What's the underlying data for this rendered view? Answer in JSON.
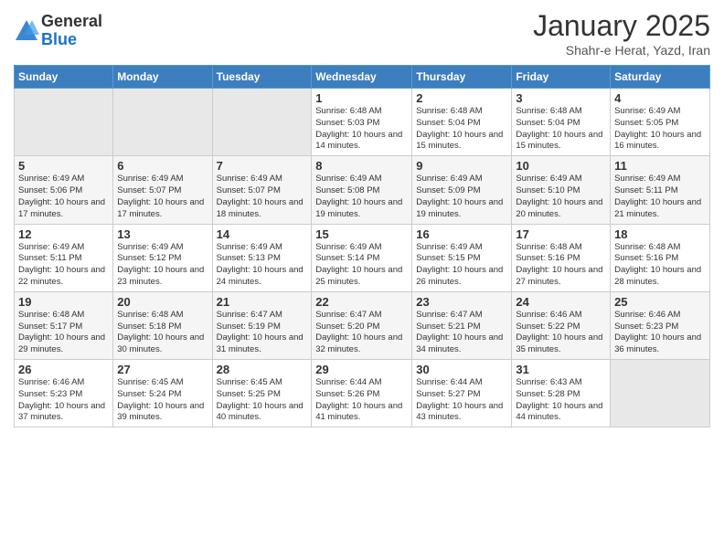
{
  "logo": {
    "general": "General",
    "blue": "Blue"
  },
  "title": "January 2025",
  "subtitle": "Shahr-e Herat, Yazd, Iran",
  "days_of_week": [
    "Sunday",
    "Monday",
    "Tuesday",
    "Wednesday",
    "Thursday",
    "Friday",
    "Saturday"
  ],
  "weeks": [
    [
      {
        "day": "",
        "info": ""
      },
      {
        "day": "",
        "info": ""
      },
      {
        "day": "",
        "info": ""
      },
      {
        "day": "1",
        "info": "Sunrise: 6:48 AM\nSunset: 5:03 PM\nDaylight: 10 hours and 14 minutes."
      },
      {
        "day": "2",
        "info": "Sunrise: 6:48 AM\nSunset: 5:04 PM\nDaylight: 10 hours and 15 minutes."
      },
      {
        "day": "3",
        "info": "Sunrise: 6:48 AM\nSunset: 5:04 PM\nDaylight: 10 hours and 15 minutes."
      },
      {
        "day": "4",
        "info": "Sunrise: 6:49 AM\nSunset: 5:05 PM\nDaylight: 10 hours and 16 minutes."
      }
    ],
    [
      {
        "day": "5",
        "info": "Sunrise: 6:49 AM\nSunset: 5:06 PM\nDaylight: 10 hours and 17 minutes."
      },
      {
        "day": "6",
        "info": "Sunrise: 6:49 AM\nSunset: 5:07 PM\nDaylight: 10 hours and 17 minutes."
      },
      {
        "day": "7",
        "info": "Sunrise: 6:49 AM\nSunset: 5:07 PM\nDaylight: 10 hours and 18 minutes."
      },
      {
        "day": "8",
        "info": "Sunrise: 6:49 AM\nSunset: 5:08 PM\nDaylight: 10 hours and 19 minutes."
      },
      {
        "day": "9",
        "info": "Sunrise: 6:49 AM\nSunset: 5:09 PM\nDaylight: 10 hours and 19 minutes."
      },
      {
        "day": "10",
        "info": "Sunrise: 6:49 AM\nSunset: 5:10 PM\nDaylight: 10 hours and 20 minutes."
      },
      {
        "day": "11",
        "info": "Sunrise: 6:49 AM\nSunset: 5:11 PM\nDaylight: 10 hours and 21 minutes."
      }
    ],
    [
      {
        "day": "12",
        "info": "Sunrise: 6:49 AM\nSunset: 5:11 PM\nDaylight: 10 hours and 22 minutes."
      },
      {
        "day": "13",
        "info": "Sunrise: 6:49 AM\nSunset: 5:12 PM\nDaylight: 10 hours and 23 minutes."
      },
      {
        "day": "14",
        "info": "Sunrise: 6:49 AM\nSunset: 5:13 PM\nDaylight: 10 hours and 24 minutes."
      },
      {
        "day": "15",
        "info": "Sunrise: 6:49 AM\nSunset: 5:14 PM\nDaylight: 10 hours and 25 minutes."
      },
      {
        "day": "16",
        "info": "Sunrise: 6:49 AM\nSunset: 5:15 PM\nDaylight: 10 hours and 26 minutes."
      },
      {
        "day": "17",
        "info": "Sunrise: 6:48 AM\nSunset: 5:16 PM\nDaylight: 10 hours and 27 minutes."
      },
      {
        "day": "18",
        "info": "Sunrise: 6:48 AM\nSunset: 5:16 PM\nDaylight: 10 hours and 28 minutes."
      }
    ],
    [
      {
        "day": "19",
        "info": "Sunrise: 6:48 AM\nSunset: 5:17 PM\nDaylight: 10 hours and 29 minutes."
      },
      {
        "day": "20",
        "info": "Sunrise: 6:48 AM\nSunset: 5:18 PM\nDaylight: 10 hours and 30 minutes."
      },
      {
        "day": "21",
        "info": "Sunrise: 6:47 AM\nSunset: 5:19 PM\nDaylight: 10 hours and 31 minutes."
      },
      {
        "day": "22",
        "info": "Sunrise: 6:47 AM\nSunset: 5:20 PM\nDaylight: 10 hours and 32 minutes."
      },
      {
        "day": "23",
        "info": "Sunrise: 6:47 AM\nSunset: 5:21 PM\nDaylight: 10 hours and 34 minutes."
      },
      {
        "day": "24",
        "info": "Sunrise: 6:46 AM\nSunset: 5:22 PM\nDaylight: 10 hours and 35 minutes."
      },
      {
        "day": "25",
        "info": "Sunrise: 6:46 AM\nSunset: 5:23 PM\nDaylight: 10 hours and 36 minutes."
      }
    ],
    [
      {
        "day": "26",
        "info": "Sunrise: 6:46 AM\nSunset: 5:23 PM\nDaylight: 10 hours and 37 minutes."
      },
      {
        "day": "27",
        "info": "Sunrise: 6:45 AM\nSunset: 5:24 PM\nDaylight: 10 hours and 39 minutes."
      },
      {
        "day": "28",
        "info": "Sunrise: 6:45 AM\nSunset: 5:25 PM\nDaylight: 10 hours and 40 minutes."
      },
      {
        "day": "29",
        "info": "Sunrise: 6:44 AM\nSunset: 5:26 PM\nDaylight: 10 hours and 41 minutes."
      },
      {
        "day": "30",
        "info": "Sunrise: 6:44 AM\nSunset: 5:27 PM\nDaylight: 10 hours and 43 minutes."
      },
      {
        "day": "31",
        "info": "Sunrise: 6:43 AM\nSunset: 5:28 PM\nDaylight: 10 hours and 44 minutes."
      },
      {
        "day": "",
        "info": ""
      }
    ]
  ]
}
